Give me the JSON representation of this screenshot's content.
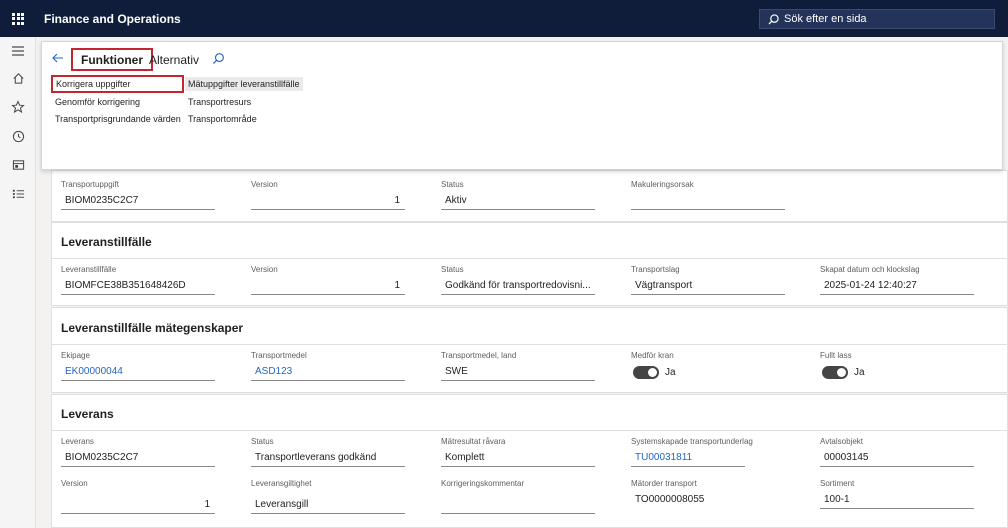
{
  "app": {
    "title": "Finance and Operations"
  },
  "search": {
    "placeholder": "Sök efter en sida"
  },
  "action_pane": {
    "tabs": {
      "functions": "Funktioner",
      "options": "Alternativ"
    },
    "items": {
      "korrigera": "Korrigera uppgifter",
      "genomfor": "Genomför korrigering",
      "transportpris": "Transportprisgrundande värden",
      "matuppgifter": "Mätuppgifter leveranstillfälle",
      "transportresurs": "Transportresurs",
      "transportomrade": "Transportområde"
    }
  },
  "header_card": {
    "fields": {
      "transportuppgift": {
        "label": "Transportuppgift",
        "value": "BIOM0235C2C7"
      },
      "version": {
        "label": "Version",
        "value": "1"
      },
      "status": {
        "label": "Status",
        "value": "Aktiv"
      },
      "makulering": {
        "label": "Makuleringsorsak",
        "value": ""
      }
    }
  },
  "leveranstillfalle": {
    "title": "Leveranstillfälle",
    "fields": {
      "lev": {
        "label": "Leveranstillfälle",
        "value": "BIOMFCE38B351648426D"
      },
      "version": {
        "label": "Version",
        "value": "1"
      },
      "status": {
        "label": "Status",
        "value": "Godkänd för transportredovisni..."
      },
      "transportslag": {
        "label": "Transportslag",
        "value": "Vägtransport"
      },
      "skapat": {
        "label": "Skapat datum och klockslag",
        "value": "2025-01-24 12:40:27"
      }
    }
  },
  "matning": {
    "title": "Leveranstillfälle mätegenskaper",
    "fields": {
      "ekipage": {
        "label": "Ekipage",
        "value": "EK00000044"
      },
      "transportmedel": {
        "label": "Transportmedel",
        "value": "ASD123"
      },
      "land": {
        "label": "Transportmedel, land",
        "value": "SWE"
      },
      "kran": {
        "label": "Medför kran",
        "value": "Ja"
      },
      "lass": {
        "label": "Fullt lass",
        "value": "Ja"
      }
    }
  },
  "leverans": {
    "title": "Leverans",
    "fields": {
      "leverans": {
        "label": "Leverans",
        "value": "BIOM0235C2C7"
      },
      "status": {
        "label": "Status",
        "value": "Transportleverans godkänd"
      },
      "matresultat": {
        "label": "Mätresultat råvara",
        "value": "Komplett"
      },
      "underlag": {
        "label": "Systemskapade transportunderlag",
        "value": "TU00031811"
      },
      "avtal": {
        "label": "Avtalsobjekt",
        "value": "00003145"
      },
      "version": {
        "label": "Version",
        "value": "1"
      },
      "giltighet": {
        "label": "Leveransgiltighet",
        "value": "Leveransgill"
      },
      "kommentar": {
        "label": "Korrigeringskommentar",
        "value": ""
      },
      "matorder": {
        "label": "Mätorder transport",
        "value": "TO0000008055"
      },
      "sortiment": {
        "label": "Sortiment",
        "value": "100-1"
      }
    }
  }
}
